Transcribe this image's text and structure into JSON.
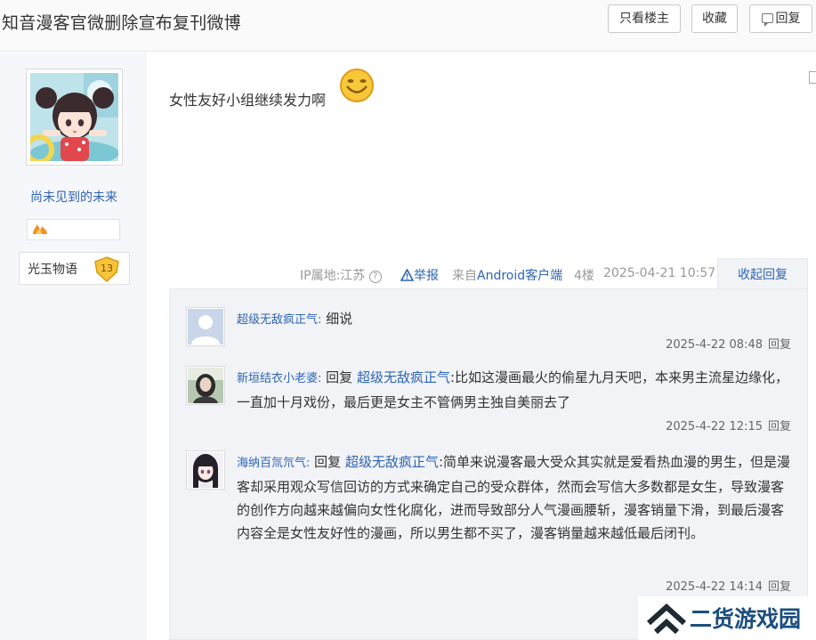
{
  "header": {
    "title": "知音漫客官微删除宣布复刊微博",
    "only_op_label": "只看楼主",
    "favorite_label": "收藏",
    "reply_label": "回复"
  },
  "author": {
    "name": "尚未见到的未来",
    "level_name": "光玉物语",
    "level": "13"
  },
  "post": {
    "content": "女性友好小组继续发力啊",
    "ip_label": "IP属地:江苏",
    "help": "?",
    "report_label": "举报",
    "client_prefix": "来自",
    "client_name": "Android客户端",
    "floor": "4楼",
    "time": "2025-04-21 10:57",
    "collapse_label": "收起回复"
  },
  "replies": [
    {
      "user": "超级无敌疯正气:",
      "reply_prefix": "",
      "target": "",
      "body": "细说",
      "time": "2025-4-22 08:48",
      "reply_label": "回复"
    },
    {
      "user": "新垣结衣小老婆:",
      "reply_prefix": "回复",
      "target": "超级无敌疯正气",
      "body": ":比如这漫画最火的偷星九月天吧，本来男主流星边缘化，一直加十月戏份，最后更是女主不管俩男主独自美丽去了",
      "time": "2025-4-22 12:15",
      "reply_label": "回复"
    },
    {
      "user": "海纳百氚氘气:",
      "reply_prefix": "回复",
      "target": "超级无敌疯正气",
      "body": ":简单来说漫客最大受众其实就是爱看热血漫的男生，但是漫客却采用观众写信回访的方式来确定自己的受众群体，然而会写信大多数都是女生，导致漫客的创作方向越来越偏向女性化腐化，进而导致部分人气漫画腰斩，漫客销量下滑，到最后漫客内容全是女性友好性的漫画，所以男生都不买了，漫客销量越来越低最后闭刊。",
      "time": "2025-4-22 14:14",
      "reply_label": "回复"
    }
  ],
  "watermark": {
    "text": "二货游戏园"
  },
  "colors": {
    "link": "#2d64b3",
    "panel": "#f1f3f7",
    "sidebar": "#f5f7fb"
  }
}
